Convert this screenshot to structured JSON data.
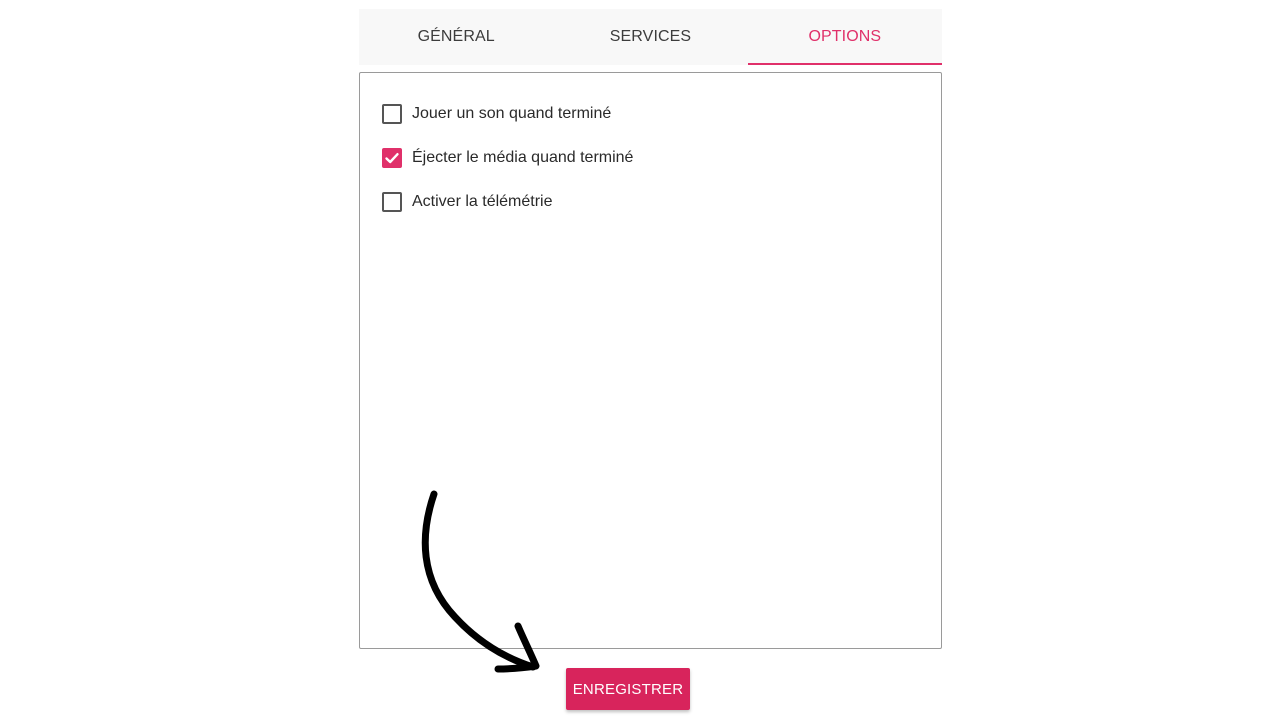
{
  "tabs": [
    {
      "label": "GÉNÉRAL",
      "active": false
    },
    {
      "label": "SERVICES",
      "active": false
    },
    {
      "label": "OPTIONS",
      "active": true
    }
  ],
  "options": [
    {
      "label": "Jouer un son quand terminé",
      "checked": false
    },
    {
      "label": "Éjecter le média quand terminé",
      "checked": true
    },
    {
      "label": "Activer la télémétrie",
      "checked": false
    }
  ],
  "save_button": {
    "label": "ENREGISTRER"
  },
  "colors": {
    "accent": "#e0306a",
    "button": "#d8245c",
    "tab_bar_bg": "#f8f8f8",
    "text": "#2a2a2a"
  },
  "annotation": {
    "icon": "curved-arrow-icon",
    "color": "#000000"
  }
}
